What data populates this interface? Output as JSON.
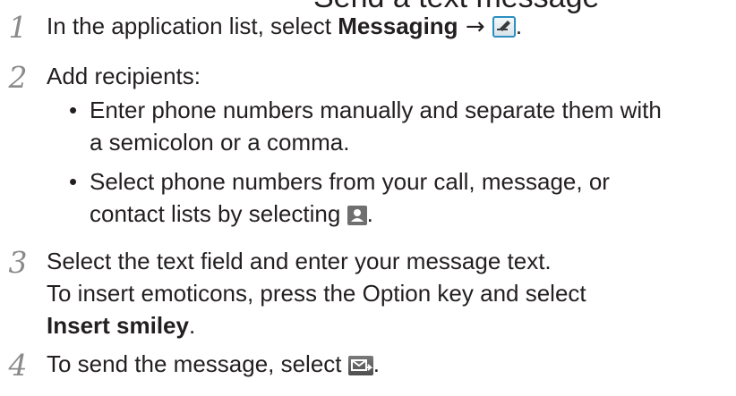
{
  "header": {
    "cut_off_title": "Send a text message"
  },
  "steps": [
    {
      "num": "1",
      "pre": "In the application list, select ",
      "bold": "Messaging",
      "arrow": " → ",
      "icon": "compose-icon",
      "post": "."
    },
    {
      "num": "2",
      "text": "Add recipients:",
      "bullets": [
        {
          "dot": "•",
          "line1": "Enter phone numbers manually and separate them with",
          "line2": "a semicolon or a comma."
        },
        {
          "dot": "•",
          "line1": "Select phone numbers from your call, message, or",
          "line2_pre": "contact lists by selecting ",
          "icon": "contact-icon",
          "line2_post": "."
        }
      ]
    },
    {
      "num": "3",
      "line1": "Select the text field and enter your message text.",
      "line2": "To insert emoticons, press the Option key and select",
      "bold": "Insert smiley",
      "post": "."
    },
    {
      "num": "4",
      "pre": "To send the message, select ",
      "icon": "send-icon",
      "post": "."
    }
  ]
}
